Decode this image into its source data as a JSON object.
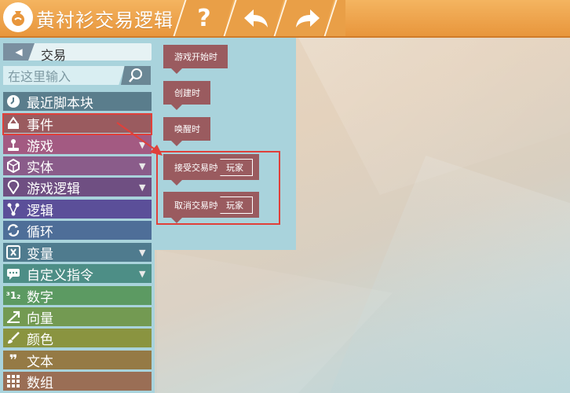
{
  "window": {
    "title": "黄衬衫交易逻辑"
  },
  "toolbar": {
    "help_glyph": "?",
    "undo_glyph": "↶",
    "redo_glyph": "↷"
  },
  "panel": {
    "back_label": "交易",
    "search": {
      "placeholder": "在这里输入"
    },
    "categories": [
      {
        "label": "最近脚本块",
        "color": "#5a7d8c",
        "icon": "clock-icon",
        "has_arrow": false
      },
      {
        "label": "事件",
        "color": "#9a5b5f",
        "icon": "event-icon",
        "has_arrow": false
      },
      {
        "label": "游戏",
        "color": "#a35a82",
        "icon": "joystick-icon",
        "has_arrow": true
      },
      {
        "label": "实体",
        "color": "#8a5c8a",
        "icon": "cube-icon",
        "has_arrow": true
      },
      {
        "label": "游戏逻辑",
        "color": "#6f4f82",
        "icon": "bulb-icon",
        "has_arrow": true
      },
      {
        "label": "逻辑",
        "color": "#5b4f99",
        "icon": "logic-icon",
        "has_arrow": false
      },
      {
        "label": "循环",
        "color": "#4e6e98",
        "icon": "loop-icon",
        "has_arrow": false
      },
      {
        "label": "变量",
        "color": "#4f7b8e",
        "icon": "variable-icon",
        "has_arrow": true
      },
      {
        "label": "自定义指令",
        "color": "#4d8e86",
        "icon": "chat-icon",
        "has_arrow": true
      },
      {
        "label": "数字",
        "color": "#5c9a62",
        "icon": "number-icon",
        "has_arrow": false
      },
      {
        "label": "向量",
        "color": "#739a52",
        "icon": "vector-icon",
        "has_arrow": false
      },
      {
        "label": "颜色",
        "color": "#8a9440",
        "icon": "brush-icon",
        "has_arrow": false
      },
      {
        "label": "文本",
        "color": "#957a45",
        "icon": "quote-icon",
        "has_arrow": false
      },
      {
        "label": "数组",
        "color": "#9a6e55",
        "icon": "grid-icon",
        "has_arrow": false
      }
    ]
  },
  "blocks": [
    {
      "label": "游戏开始时"
    },
    {
      "label": "创建时"
    },
    {
      "label": "唤醒时"
    },
    {
      "label": "接受交易时",
      "slot": "玩家"
    },
    {
      "label": "取消交易时",
      "slot": "玩家"
    }
  ],
  "colors": {
    "accent": "#e8963c",
    "event_block": "#9a5b5f",
    "highlight": "#e0403a"
  }
}
